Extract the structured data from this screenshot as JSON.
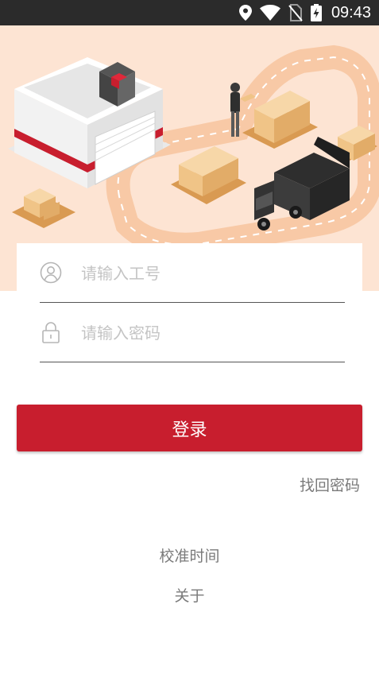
{
  "status_bar": {
    "time": "09:43",
    "icons": [
      "location-icon",
      "wifi-icon",
      "no-sim-icon",
      "battery-charging-icon"
    ]
  },
  "hero": {
    "illustration": "warehouse-logistics-illustration"
  },
  "login_form": {
    "username": {
      "icon": "user-icon",
      "placeholder": "请输入工号",
      "value": ""
    },
    "password": {
      "icon": "lock-icon",
      "placeholder": "请输入密码",
      "value": ""
    },
    "login_label": "登录"
  },
  "links": {
    "forgot_password": "找回密码",
    "calibrate_time": "校准时间",
    "about": "关于"
  },
  "colors": {
    "accent": "#c81e2e",
    "hero_background": "#fde4d3",
    "status_bar": "#2b2b2b"
  }
}
